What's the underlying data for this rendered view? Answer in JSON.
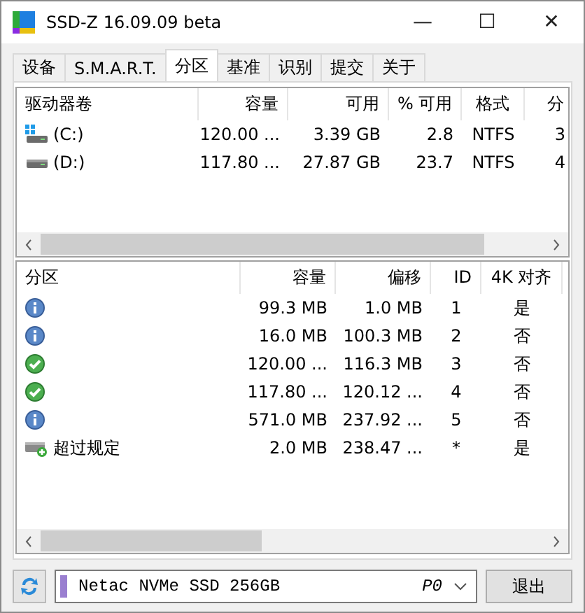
{
  "window": {
    "title": "SSD-Z 16.09.09 beta",
    "controls": [
      "—",
      "☐",
      "✕"
    ]
  },
  "tabs": [
    {
      "label": "设备",
      "selected": false
    },
    {
      "label": "S.M.A.R.T.",
      "selected": false
    },
    {
      "label": "分区",
      "selected": true
    },
    {
      "label": "基准",
      "selected": false
    },
    {
      "label": "识别",
      "selected": false
    },
    {
      "label": "提交",
      "selected": false
    },
    {
      "label": "关于",
      "selected": false
    }
  ],
  "volumes": {
    "columns": [
      "驱动器卷",
      "容量",
      "可用",
      "% 可用",
      "格式",
      "分"
    ],
    "rows": [
      {
        "kind": "system",
        "cells": [
          "(C:)",
          "120.00 ...",
          "3.39 GB",
          "2.8",
          "NTFS",
          "3"
        ]
      },
      {
        "kind": "drive",
        "cells": [
          "(D:)",
          "117.80 ...",
          "27.87 GB",
          "23.7",
          "NTFS",
          "4"
        ]
      }
    ]
  },
  "partitions": {
    "columns": [
      "分区",
      "容量",
      "偏移",
      "ID",
      "4K 对齐"
    ],
    "rows": [
      {
        "kind": "info",
        "cells": [
          "",
          "99.3 MB",
          "1.0 MB",
          "1",
          "是"
        ]
      },
      {
        "kind": "info",
        "cells": [
          "",
          "16.0 MB",
          "100.3 MB",
          "2",
          "否"
        ]
      },
      {
        "kind": "ok",
        "cells": [
          "",
          "120.00 ...",
          "116.3 MB",
          "3",
          "否"
        ]
      },
      {
        "kind": "ok",
        "cells": [
          "",
          "117.80 ...",
          "120.12 ...",
          "4",
          "否"
        ]
      },
      {
        "kind": "info",
        "cells": [
          "",
          "571.0 MB",
          "237.92 ...",
          "5",
          "否"
        ]
      },
      {
        "kind": "unallocated",
        "cells": [
          "超过规定",
          "2.0 MB",
          "238.47 ...",
          "*",
          "是"
        ]
      }
    ]
  },
  "footer": {
    "device": "Netac NVMe SSD 256GB",
    "port": "P0",
    "exit_button": "退出"
  }
}
